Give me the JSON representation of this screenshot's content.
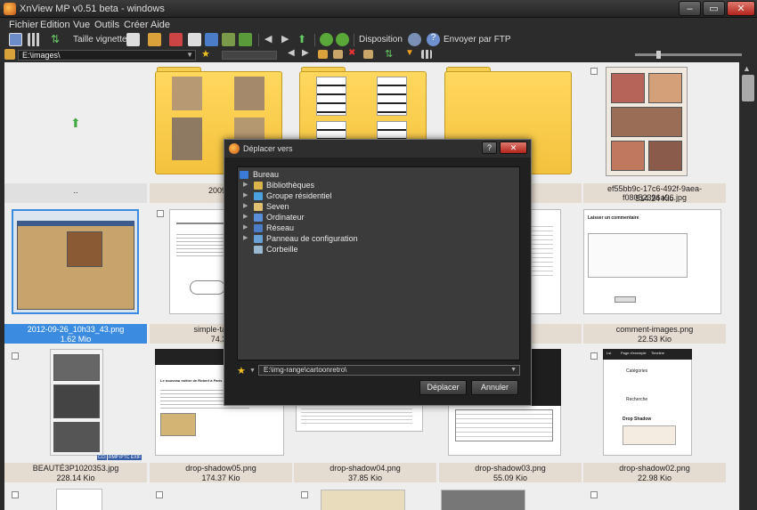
{
  "window": {
    "title": "XnView MP v0.51 beta - windows",
    "min": "–",
    "max": "▭",
    "close": "✕"
  },
  "menu": [
    "Fichier",
    "Edition",
    "Vue",
    "Outils",
    "Créer",
    "Aide"
  ],
  "toolbar": {
    "thumb_size_label": "Taille vignette",
    "layout_label": "Disposition",
    "ftp_label": "Envoyer par FTP"
  },
  "address": {
    "path": "E:\\images\\"
  },
  "browser": {
    "items": [
      {
        "name": "..",
        "size": ""
      },
      {
        "name": "2009-0",
        "size": ""
      },
      {
        "name": "",
        "size": ""
      },
      {
        "name": "",
        "size": ""
      },
      {
        "name": "ef55bb9c-17c6-492f-9aea-f08052396a96.jpg",
        "size": "514.24 Kio"
      },
      {
        "name": "2012-09-26_10h33_43.png",
        "size": "1.62 Mio"
      },
      {
        "name": "simple-table-co",
        "size": "74.36"
      },
      {
        "name": "png",
        "size": ""
      },
      {
        "name": "comment-images.png",
        "size": "22.53 Kio"
      },
      {
        "name": "BEAUTÉ3P1020353.jpg",
        "size": "228.14 Kio"
      },
      {
        "name": "drop-shadow05.png",
        "size": "174.37 Kio"
      },
      {
        "name": "drop-shadow04.png",
        "size": "37.85 Kio"
      },
      {
        "name": "drop-shadow03.png",
        "size": "55.09 Kio"
      },
      {
        "name": "drop-shadow02.png",
        "size": "22.98 Kio"
      }
    ],
    "thumb_texts": {
      "comment_title": "Laisser un commentaire",
      "categories": "Catégories",
      "recherche": "Recherche",
      "drop_shadow": "Drop Shadow",
      "blog_title": "Le nouveau métier de Robert à Paris",
      "nav1": "Lst",
      "nav2": "Page d'exemple",
      "nav3": "Timeline"
    },
    "badges": [
      "CCI",
      "RMP",
      "IPTC",
      "EXIF"
    ]
  },
  "dialog": {
    "title": "Déplacer vers",
    "help": "?",
    "close": "✕",
    "tree": [
      {
        "label": "Bureau",
        "color": "#3a7bd5"
      },
      {
        "label": "Bibliothèques",
        "color": "#d9b44a"
      },
      {
        "label": "Groupe résidentiel",
        "color": "#4aa3df"
      },
      {
        "label": "Seven",
        "color": "#e0c070"
      },
      {
        "label": "Ordinateur",
        "color": "#5b8fd9"
      },
      {
        "label": "Réseau",
        "color": "#4a7cc8"
      },
      {
        "label": "Panneau de configuration",
        "color": "#6aa0d8"
      },
      {
        "label": "Corbeille",
        "color": "#9ab8d0"
      }
    ],
    "destination": "E:\\img-range\\cartoonretro\\",
    "move_button": "Déplacer",
    "cancel_button": "Annuler"
  }
}
